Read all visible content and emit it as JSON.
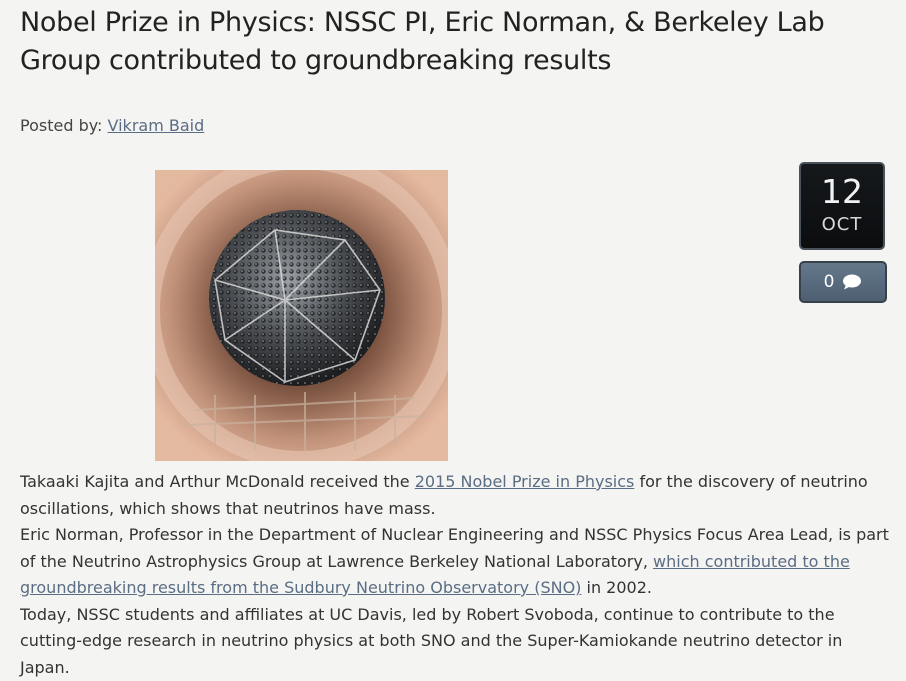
{
  "post": {
    "title": "Nobel Prize in Physics: NSSC PI, Eric Norman, & Berkeley Lab Group contributed to groundbreaking results",
    "posted_by_label": "Posted by:",
    "author": "Vikram Baid"
  },
  "date": {
    "day": "12",
    "month": "OCT"
  },
  "comments": {
    "count": "0",
    "icon": "comment-bubble-icon"
  },
  "image": {
    "subject": "neutrino-detector-sphere-photo"
  },
  "paragraphs": {
    "p1": {
      "before": "Takaaki Kajita and Arthur McDonald received the ",
      "link": "2015 Nobel Prize in Physics",
      "after": " for the discovery of neutrino oscillations, which shows that neutrinos have mass."
    },
    "p2": {
      "before": "Eric Norman, Professor in the Department of Nuclear Engineering and NSSC Physics Focus Area Lead, is part of the Neutrino Astrophysics Group at Lawrence Berkeley National Laboratory, ",
      "link": "which contributed to the groundbreaking results from the Sudbury Neutrino Observatory (SNO)",
      "after": " in 2002."
    },
    "p3": {
      "text": "Today, NSSC students and affiliates at UC Davis, led by Robert Svoboda, continue to contribute to the cutting-edge research in neutrino physics at both SNO and the Super-Kamiokande neutrino detector in Japan."
    }
  },
  "colors": {
    "background": "#f4f4f2",
    "link": "#5b6d84",
    "date_box": "#0b0d0f",
    "comment_box": "#5a6c7e"
  }
}
